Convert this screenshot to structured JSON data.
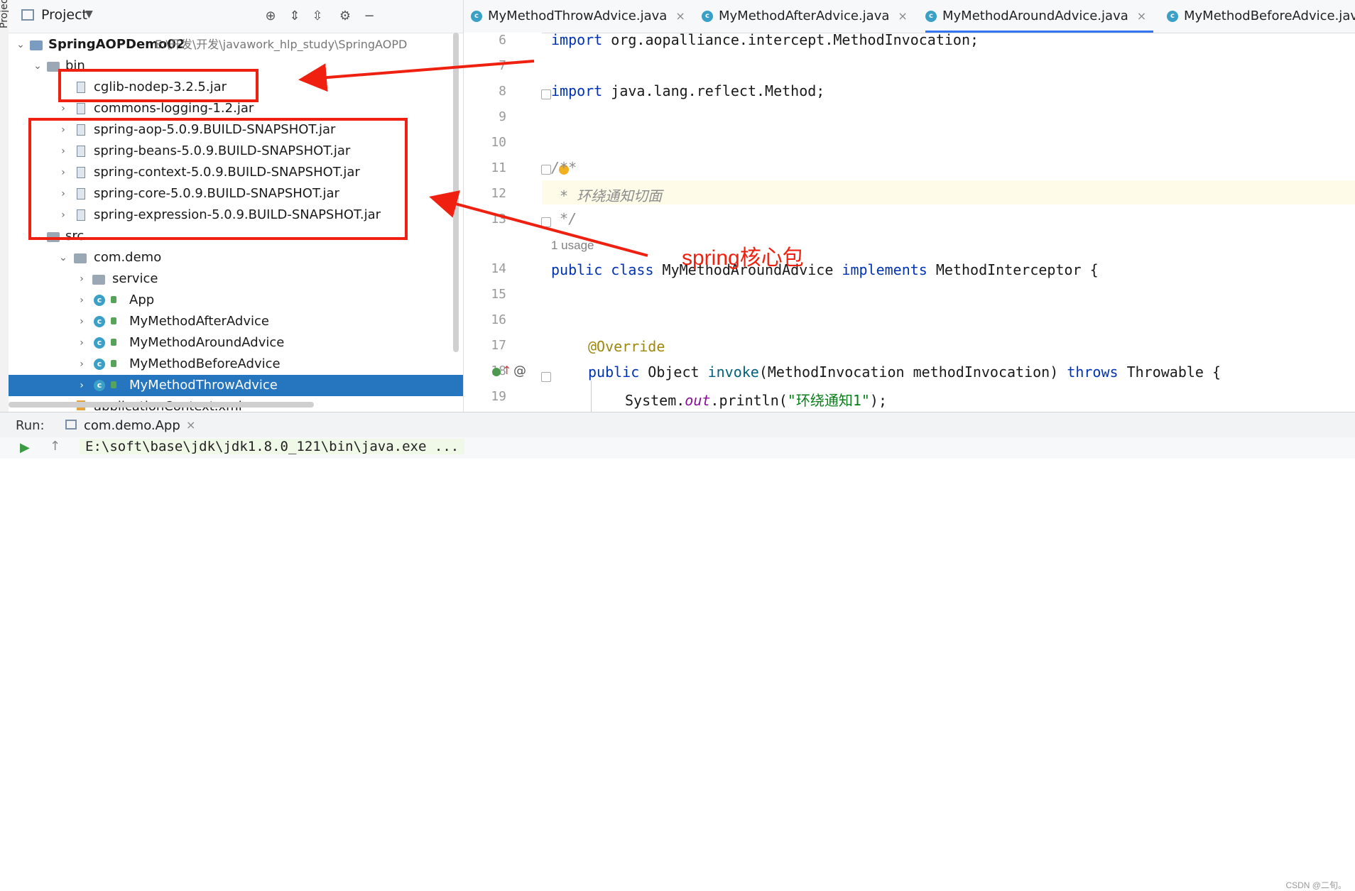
{
  "side_strip_label": "Project",
  "project_panel": {
    "title": "Project",
    "tree": [
      {
        "label": "SpringAOPDemo02",
        "extra": "E:\\开发\\开发\\javawork_hlp_study\\SpringAOPD",
        "level": 0,
        "expanded": true,
        "icon": "module-folder-icon",
        "bold": true
      },
      {
        "label": "bin",
        "level": 1,
        "expanded": true,
        "icon": "folder-icon"
      },
      {
        "label": "cglib-nodep-3.2.5.jar",
        "level": 2,
        "icon": "jar-icon"
      },
      {
        "label": "commons-logging-1.2.jar",
        "level": 2,
        "icon": "jar-icon",
        "collapsed": true
      },
      {
        "label": "spring-aop-5.0.9.BUILD-SNAPSHOT.jar",
        "level": 2,
        "icon": "jar-icon",
        "collapsed": true
      },
      {
        "label": "spring-beans-5.0.9.BUILD-SNAPSHOT.jar",
        "level": 2,
        "icon": "jar-icon",
        "collapsed": true
      },
      {
        "label": "spring-context-5.0.9.BUILD-SNAPSHOT.jar",
        "level": 2,
        "icon": "jar-icon",
        "collapsed": true
      },
      {
        "label": "spring-core-5.0.9.BUILD-SNAPSHOT.jar",
        "level": 2,
        "icon": "jar-icon",
        "collapsed": true
      },
      {
        "label": "spring-expression-5.0.9.BUILD-SNAPSHOT.jar",
        "level": 2,
        "icon": "jar-icon",
        "collapsed": true
      },
      {
        "label": "src",
        "level": 1,
        "expanded": true,
        "icon": "folder-icon"
      },
      {
        "label": "com.demo",
        "level": 2,
        "expanded": true,
        "icon": "package-icon"
      },
      {
        "label": "service",
        "level": 3,
        "icon": "package-icon",
        "collapsed": true
      },
      {
        "label": "App",
        "level": 3,
        "icon": "class-icon",
        "collapsed": true
      },
      {
        "label": "MyMethodAfterAdvice",
        "level": 3,
        "icon": "class-icon",
        "collapsed": true
      },
      {
        "label": "MyMethodAroundAdvice",
        "level": 3,
        "icon": "class-icon",
        "collapsed": true
      },
      {
        "label": "MyMethodBeforeAdvice",
        "level": 3,
        "icon": "class-icon",
        "collapsed": true
      },
      {
        "label": "MyMethodThrowAdvice",
        "level": 3,
        "icon": "class-icon",
        "collapsed": true,
        "selected": true
      },
      {
        "label": "applicationContext.xml",
        "level": 2,
        "icon": "xml-icon"
      }
    ]
  },
  "tabs": [
    {
      "label": "MyMethodThrowAdvice.java",
      "active": false
    },
    {
      "label": "MyMethodAfterAdvice.java",
      "active": false
    },
    {
      "label": "MyMethodAroundAdvice.java",
      "active": true
    },
    {
      "label": "MyMethodBeforeAdvice.java",
      "active": false
    }
  ],
  "editor": {
    "line_numbers": [
      "6",
      "7",
      "8",
      "9",
      "10",
      "11",
      "12",
      "13",
      "14",
      "15",
      "16",
      "17",
      "18",
      "19"
    ],
    "usage_hint": "1 usage",
    "code": {
      "l6_kw": "import",
      "l6_rest": " org.aopalliance.intercept.MethodInvocation;",
      "l8_kw": "import",
      "l8_rest": " java.lang.reflect.Method;",
      "l11": "/**",
      "l12": " * 环绕通知切面",
      "l13": " */",
      "l14_kw1": "public class",
      "l14_name": " MyMethodAroundAdvice ",
      "l14_kw2": "implements",
      "l14_rest": " MethodInterceptor {",
      "l17": "@Override",
      "l18_kw": "public",
      "l18_type": " Object ",
      "l18_mth": "invoke",
      "l18_args": "(MethodInvocation methodInvocation) ",
      "l18_kw2": "throws",
      "l18_rest": " Throwable {",
      "l19_a": "System.",
      "l19_fld": "out",
      "l19_b": ".println(",
      "l19_str": "\"环绕通知1\"",
      "l19_c": ");"
    }
  },
  "annotation_label": "spring核心包",
  "run_bar": {
    "label": "Run:",
    "config": "com.demo.App",
    "console_line": "E:\\soft\\base\\jdk\\jdk1.8.0_121\\bin\\java.exe ..."
  },
  "watermark": "CSDN @二旬。",
  "colors": {
    "selection": "#2675bf",
    "annotation_red": "#f02010",
    "keyword": "#0033b3",
    "annotation": "#9e880d",
    "string": "#067d17"
  }
}
